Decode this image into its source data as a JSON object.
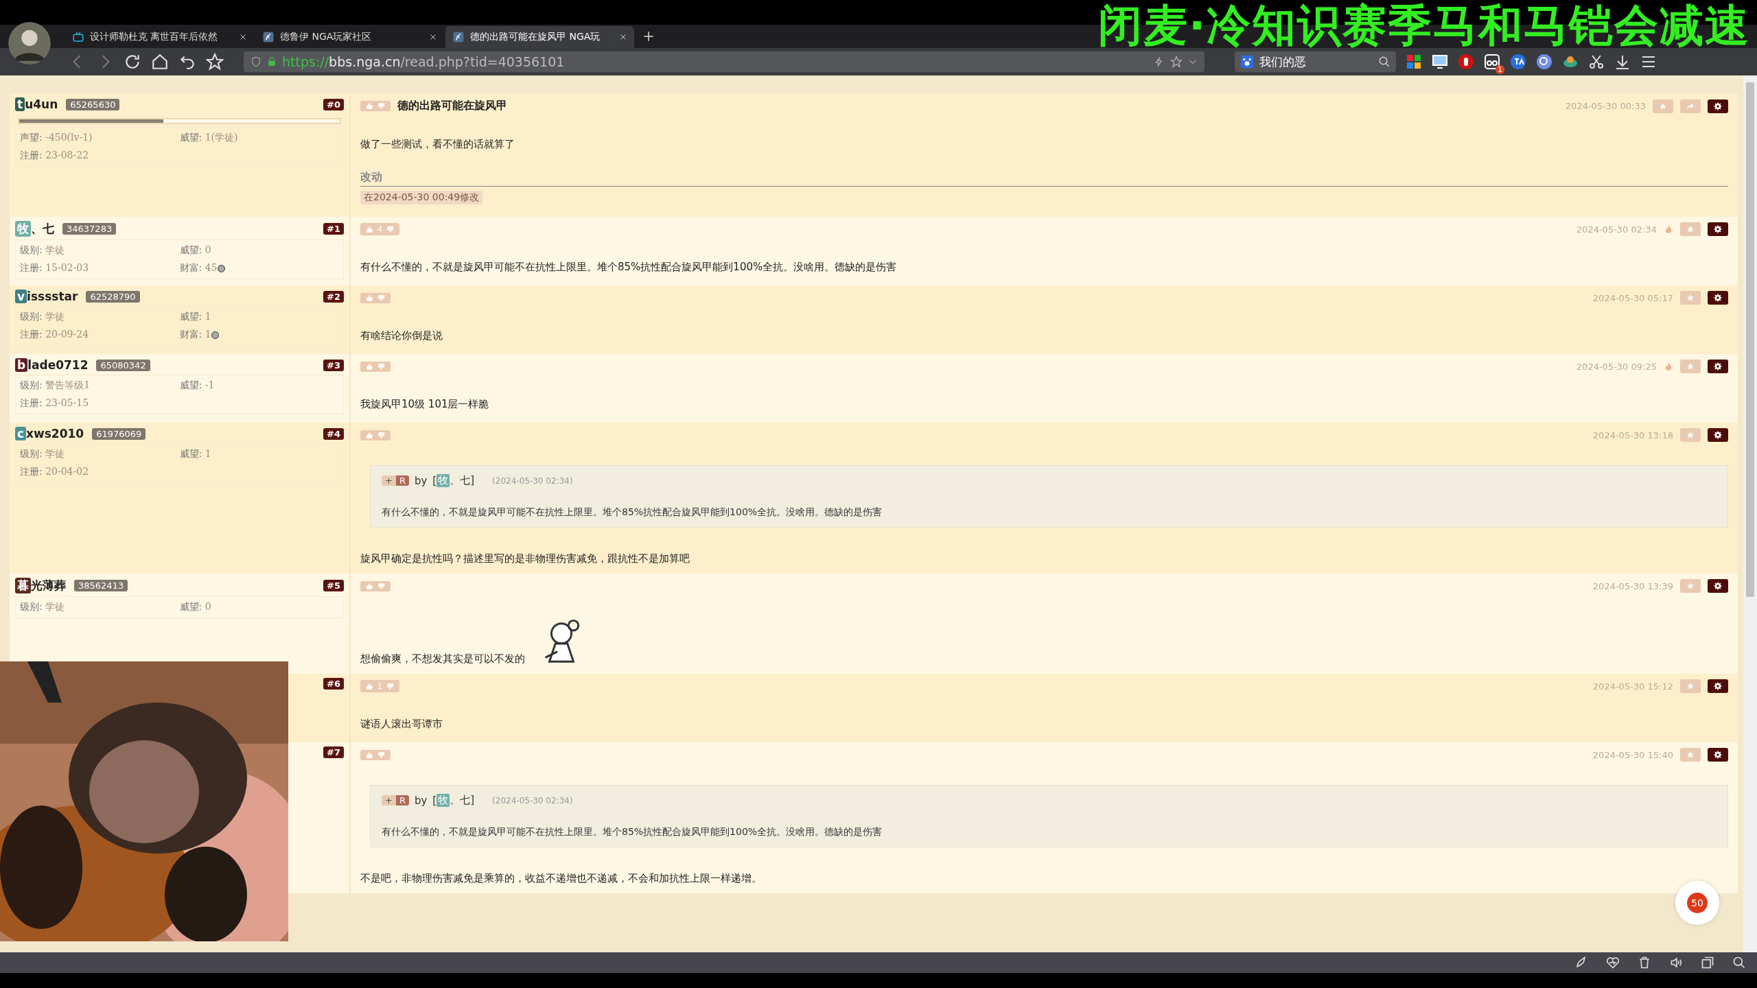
{
  "stream_overlay": {
    "title": "闭麦·冷知识赛季马和马铠会减速"
  },
  "browser": {
    "tabs": [
      {
        "title": "设计师勒杜克 离世百年后依然",
        "selected": false
      },
      {
        "title": "德鲁伊 NGA玩家社区",
        "selected": false
      },
      {
        "title": "德的出路可能在旋风甲 NGA玩",
        "selected": true
      }
    ],
    "address": {
      "scheme": "https://",
      "host": "bbs.nga.cn",
      "path": "/read.php?tid=40356101"
    },
    "search": {
      "value": "我们的恶"
    },
    "extension_badge": "1"
  },
  "posts": [
    {
      "floor": "#0",
      "user": {
        "initial": "t",
        "name": "u4un",
        "uid": "65265630",
        "level": 0.45,
        "fields": [
          {
            "label": "声望:",
            "value": "-450(lv-1)"
          },
          {
            "label": "威望:",
            "value": "1(学徒)"
          },
          {
            "label": "注册:",
            "value": "23-08-22"
          }
        ]
      },
      "title": "德的出路可能在旋风甲",
      "time": "2024-05-30 00:33",
      "hot": false,
      "share": true,
      "blocks": [
        {
          "kind": "text",
          "text": "做了一些测试，看不懂的话就算了"
        },
        {
          "kind": "edit",
          "heading": "改动",
          "note": "在2024-05-30 00:49修改"
        }
      ]
    },
    {
      "floor": "#1",
      "user": {
        "initial": "牧",
        "name": "、七",
        "uid": "34637283",
        "fields": [
          {
            "label": "级别:",
            "value": "学徒"
          },
          {
            "label": "威望:",
            "value": "0"
          },
          {
            "label": "注册:",
            "value": "15-02-03"
          },
          {
            "label": "财富:",
            "value": "45",
            "coin": true
          }
        ]
      },
      "likes": "4",
      "time": "2024-05-30 02:34",
      "hot": true,
      "share": false,
      "blocks": [
        {
          "kind": "text",
          "text": "有什么不懂的，不就是旋风甲可能不在抗性上限里。堆个85%抗性配合旋风甲能到100%全抗。没啥用。德缺的是伤害"
        }
      ]
    },
    {
      "floor": "#2",
      "user": {
        "initial": "v",
        "name": "isssstar",
        "uid": "62528790",
        "fields": [
          {
            "label": "级别:",
            "value": "学徒"
          },
          {
            "label": "威望:",
            "value": "1"
          },
          {
            "label": "注册:",
            "value": "20-09-24"
          },
          {
            "label": "财富:",
            "value": "1",
            "coin": true
          }
        ]
      },
      "time": "2024-05-30 05:17",
      "hot": false,
      "share": false,
      "blocks": [
        {
          "kind": "text",
          "text": "有啥结论你倒是说"
        }
      ]
    },
    {
      "floor": "#3",
      "user": {
        "initial": "b",
        "name": "lade0712",
        "uid": "65080342",
        "fields": [
          {
            "label": "级别:",
            "value": "警告等级1"
          },
          {
            "label": "威望:",
            "value": "-1"
          },
          {
            "label": "注册:",
            "value": "23-05-15"
          }
        ]
      },
      "time": "2024-05-30 09:25",
      "hot": true,
      "share": false,
      "blocks": [
        {
          "kind": "text",
          "text": "我旋风甲10级 101层一样脆"
        }
      ]
    },
    {
      "floor": "#4",
      "user": {
        "initial": "c",
        "name": "xws2010",
        "uid": "61976069",
        "fields": [
          {
            "label": "级别:",
            "value": "学徒"
          },
          {
            "label": "威望:",
            "value": "1"
          },
          {
            "label": "注册:",
            "value": "20-04-02"
          }
        ]
      },
      "time": "2024-05-30 13:18",
      "hot": false,
      "share": false,
      "blocks": [
        {
          "kind": "quote",
          "plus": "+",
          "tag": "R",
          "by": "by",
          "author_open": "[",
          "author_initial": "牧",
          "author_name": "、七]",
          "time": "(2024-05-30 02:34)",
          "text": "有什么不懂的，不就是旋风甲可能不在抗性上限里。堆个85%抗性配合旋风甲能到100%全抗。没啥用。德缺的是伤害"
        },
        {
          "kind": "text",
          "text": "旋风甲确定是抗性吗？描述里写的是非物理伤害减免，跟抗性不是加算吧"
        }
      ]
    },
    {
      "floor": "#5",
      "user": {
        "initial": "暮",
        "name": "光薄葬",
        "uid": "38562413",
        "fields": [
          {
            "label": "级别:",
            "value": "学徒"
          },
          {
            "label": "威望:",
            "value": "0"
          }
        ]
      },
      "time": "2024-05-30 13:39",
      "hot": false,
      "share": false,
      "blocks": [
        {
          "kind": "text",
          "text": "想偷偷爽，不想发其实是可以不发的",
          "sticker": true
        }
      ]
    },
    {
      "floor": "#6",
      "likes": "1",
      "time": "2024-05-30 15:12",
      "hot": false,
      "share": false,
      "blocks": [
        {
          "kind": "text",
          "text": "谜语人滚出哥谭市"
        }
      ]
    },
    {
      "floor": "#7",
      "time": "2024-05-30 15:40",
      "hot": false,
      "share": false,
      "blocks": [
        {
          "kind": "quote",
          "plus": "+",
          "tag": "R",
          "by": "by",
          "author_open": "[",
          "author_initial": "牧",
          "author_name": "、七]",
          "time": "(2024-05-30 02:34)",
          "text": "有什么不懂的，不就是旋风甲可能不在抗性上限里。堆个85%抗性配合旋风甲能到100%全抗。没啥用。德缺的是伤害"
        },
        {
          "kind": "text",
          "text": "不是吧，非物理伤害减免是乘算的，收益不递增也不递减，不会和加抗性上限一样递增。"
        }
      ]
    }
  ],
  "floating_badge": "50"
}
